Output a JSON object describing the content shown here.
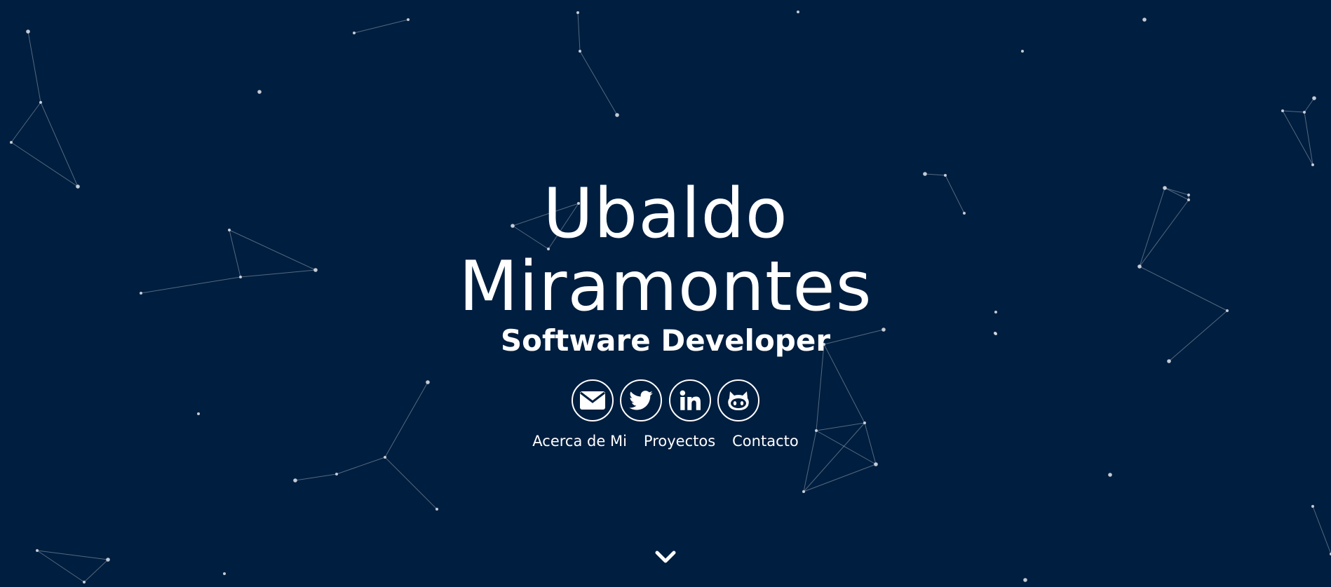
{
  "hero": {
    "name_first": "Ubaldo",
    "name_last": "Miramontes",
    "subtitle": "Software Developer"
  },
  "socials": [
    {
      "icon": "envelope-icon",
      "label": "Email"
    },
    {
      "icon": "twitter-icon",
      "label": "Twitter"
    },
    {
      "icon": "linkedin-icon",
      "label": "LinkedIn"
    },
    {
      "icon": "github-icon",
      "label": "GitHub"
    }
  ],
  "nav": {
    "about": "Acerca de Mi",
    "projects": "Proyectos",
    "contact": "Contacto"
  },
  "colors": {
    "background": "#001e3f",
    "foreground": "#ffffff",
    "network": "#b7c3d3"
  },
  "icons": {
    "scroll_down": "chevron-down-icon"
  }
}
